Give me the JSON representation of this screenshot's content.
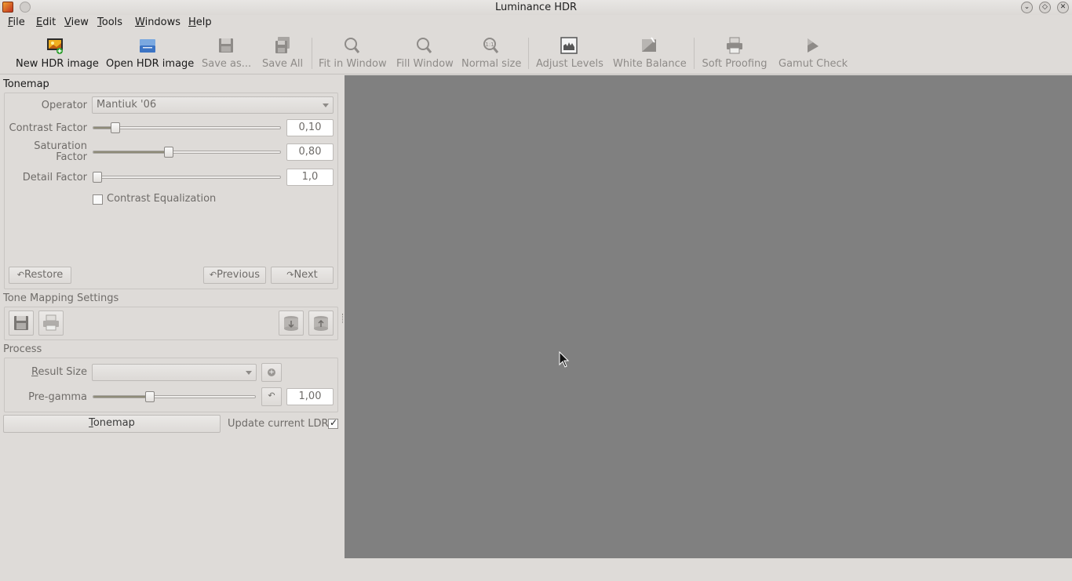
{
  "window": {
    "title": "Luminance HDR"
  },
  "menu": {
    "items": [
      {
        "mnemonic": "F",
        "rest": "ile"
      },
      {
        "mnemonic": "E",
        "rest": "dit"
      },
      {
        "mnemonic": "V",
        "rest": "iew"
      },
      {
        "mnemonic": "T",
        "rest": "ools"
      },
      {
        "mnemonic": "W",
        "rest": "indows"
      },
      {
        "mnemonic": "H",
        "rest": "elp"
      }
    ]
  },
  "toolbar": {
    "new_hdr": "New HDR image",
    "open_hdr": "Open HDR image",
    "save_as": "Save as...",
    "save_all": "Save All",
    "fit_window": "Fit in Window",
    "fill_window": "Fill Window",
    "normal_size": "Normal size",
    "adjust_levels": "Adjust Levels",
    "white_balance": "White Balance",
    "soft_proofing": "Soft Proofing",
    "gamut_check": "Gamut Check"
  },
  "tonemap": {
    "section_title": "Tonemap",
    "operator_label": "Operator",
    "operator_value": "Mantiuk '06",
    "contrast_label": "Contrast Factor",
    "contrast_value": "0,10",
    "contrast_fraction": 0.1,
    "saturation_label_1": "Saturation",
    "saturation_label_2": "Factor",
    "saturation_value": "0,80",
    "saturation_fraction": 0.4,
    "detail_label": "Detail Factor",
    "detail_value": "1,0",
    "detail_fraction": 0.0,
    "equalization_label": "Contrast Equalization",
    "equalization_checked": false,
    "restore": "Restore",
    "previous": "Previous",
    "next": "Next"
  },
  "settings": {
    "section_title": "Tone Mapping Settings"
  },
  "process": {
    "section_title": "Process",
    "result_size_mnemonic": "R",
    "result_size_rest": "esult Size",
    "result_size_value": "",
    "pregamma_label": "Pre-gamma",
    "pregamma_value": "1,00",
    "pregamma_fraction": 0.34,
    "tonemap_mnemonic": "T",
    "tonemap_rest": "onemap",
    "update_ldr_label": "Update current LDR",
    "update_ldr_checked": true
  },
  "colors": {
    "viewport": "#808080",
    "background": "#dedbd8"
  }
}
